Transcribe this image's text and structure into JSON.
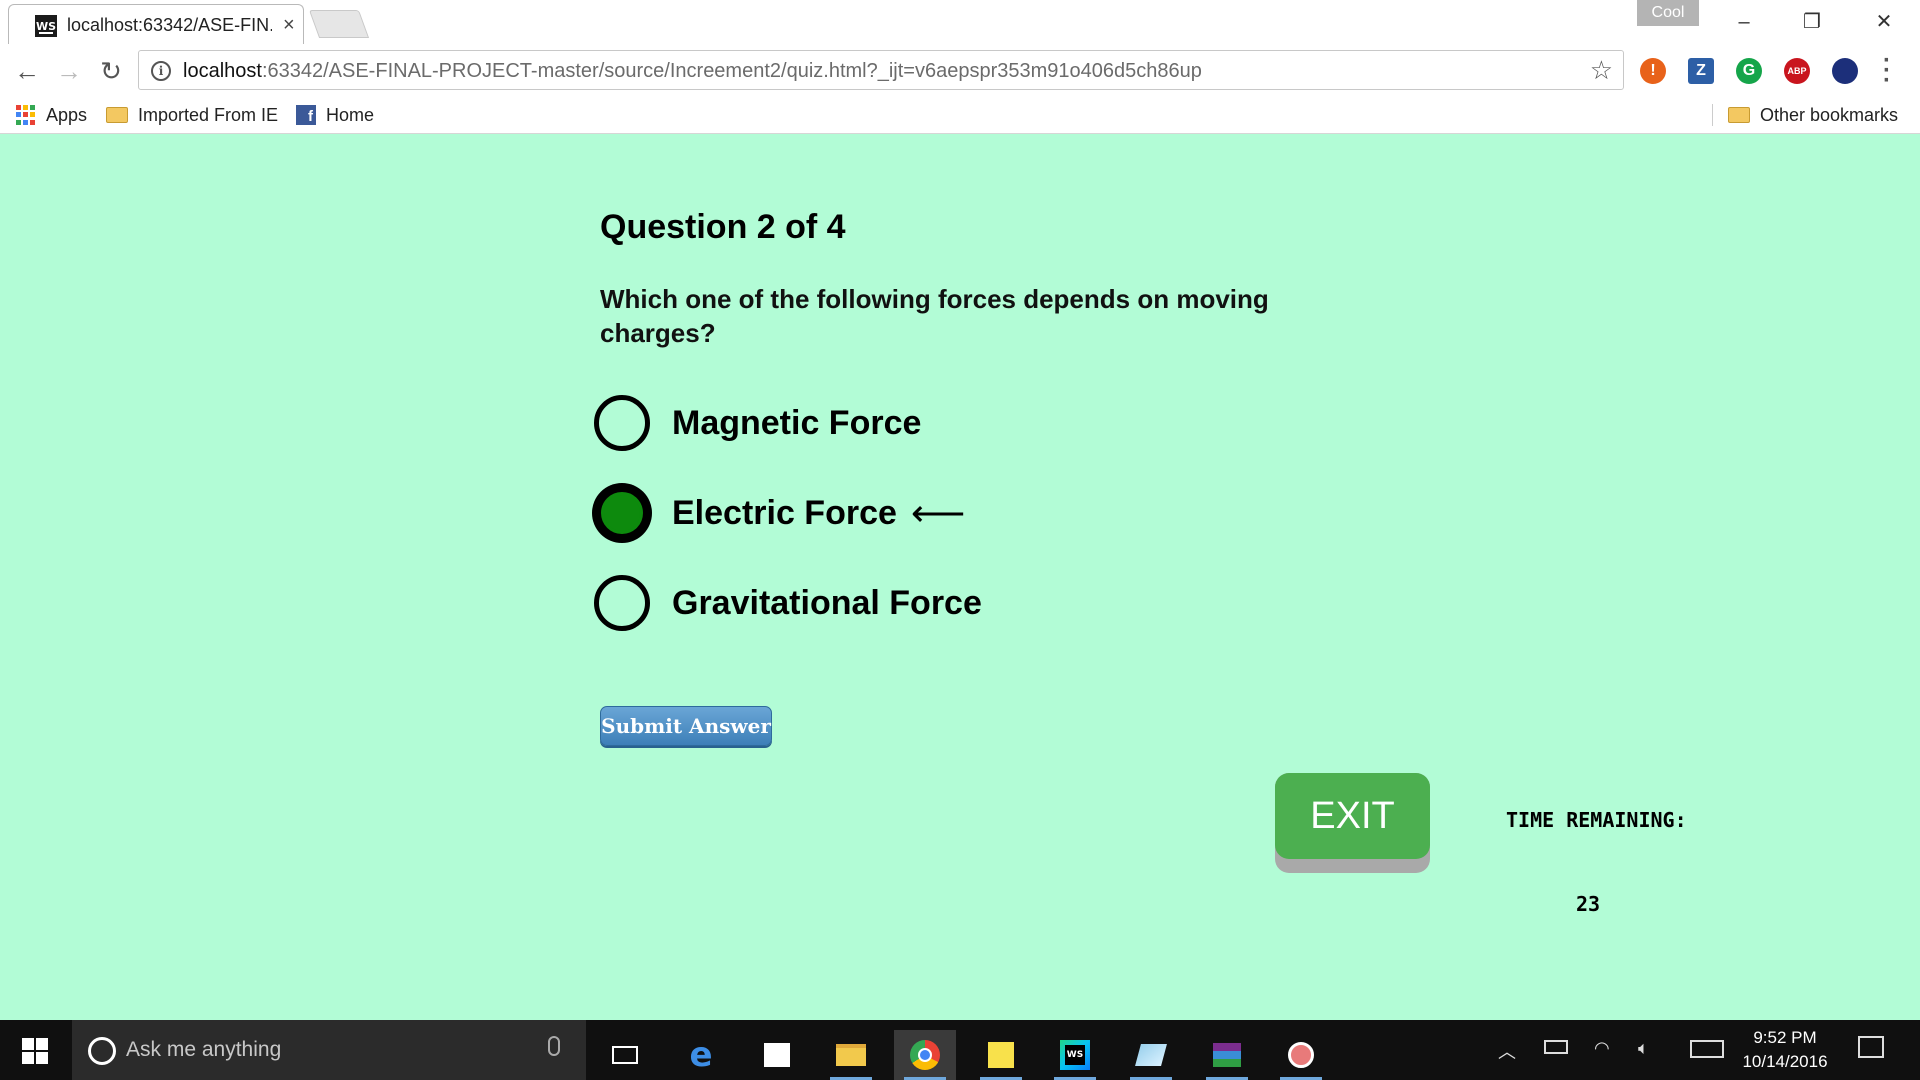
{
  "browser": {
    "tab_title": "localhost:63342/ASE-FIN...",
    "tab_favicon_text": "WS",
    "profile_name": "Cool",
    "url_host": "localhost",
    "url_rest": ":63342/ASE-FINAL-PROJECT-master/source/Increement2/quiz.html?_ijt=v6aepspr353m91o406d5ch86up",
    "extensions": [
      {
        "name": "alert-extension-icon",
        "glyph": "!",
        "color": "#e8621a"
      },
      {
        "name": "zotero-extension-icon",
        "glyph": "Z",
        "color": "#2d5fa6"
      },
      {
        "name": "grammarly-extension-icon",
        "glyph": "G",
        "color": "#15a54a"
      },
      {
        "name": "adblock-extension-icon",
        "glyph": "ABP",
        "color": "#c9151e"
      },
      {
        "name": "lens-extension-icon",
        "glyph": "",
        "color": "#1c2f7a"
      }
    ],
    "bookmarks": {
      "apps": "Apps",
      "imported": "Imported From IE",
      "home": "Home",
      "other": "Other bookmarks"
    }
  },
  "quiz": {
    "heading": "Question 2 of 4",
    "question": "Which one of the following forces depends on moving charges?",
    "options": [
      {
        "label": "Magnetic Force",
        "selected": false
      },
      {
        "label": "Electric Force",
        "selected": true
      },
      {
        "label": "Gravitational Force",
        "selected": false
      }
    ],
    "selected_marker": "⟵",
    "submit_label": "Submit Answer",
    "exit_label": "EXIT",
    "timer_label": "TIME REMAINING:",
    "timer_value": "23"
  },
  "taskbar": {
    "search_placeholder": "Ask me anything",
    "time": "9:52 PM",
    "date": "10/14/2016"
  },
  "colors": {
    "page_background": "#b2fcd6",
    "selected_radio": "#0d8a0d",
    "exit_button": "#4caf50",
    "submit_button": "#3d7fb8"
  }
}
